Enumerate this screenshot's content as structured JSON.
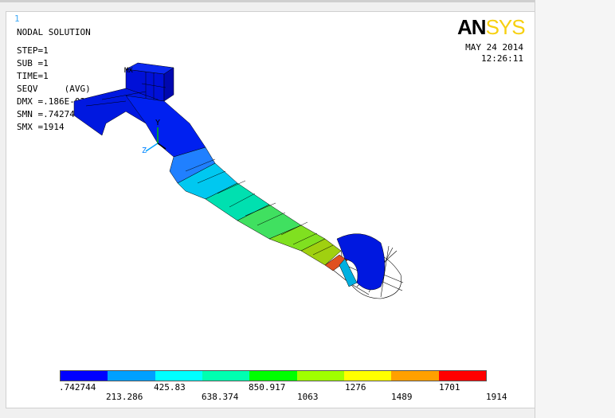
{
  "window": {
    "number": "1"
  },
  "logo": {
    "an": "AN",
    "sys": "SYS"
  },
  "header": {
    "title": "NODAL SOLUTION",
    "step": "STEP=1",
    "sub": "SUB =1",
    "time": "TIME=1",
    "seqv": "SEQV     (AVG)",
    "dmx": "DMX =.186E-03",
    "smn": "SMN =.742744",
    "smx": "SMX =1914"
  },
  "date": {
    "day": "MAY 24 2014",
    "time": "12:26:11"
  },
  "triad": {
    "y": "Y",
    "z": "Z",
    "mx": "MX"
  },
  "legend": {
    "colors": [
      "#0000ff",
      "#00a0ff",
      "#00ffff",
      "#00ffb0",
      "#00ff00",
      "#a0ff00",
      "#ffff00",
      "#ffa000",
      "#ff0000"
    ],
    "labels_top": [
      ".742744",
      "425.83",
      "850.917",
      "1276",
      "1701"
    ],
    "labels_bottom": [
      "213.286",
      "638.374",
      "1063",
      "1489",
      "1914"
    ]
  }
}
